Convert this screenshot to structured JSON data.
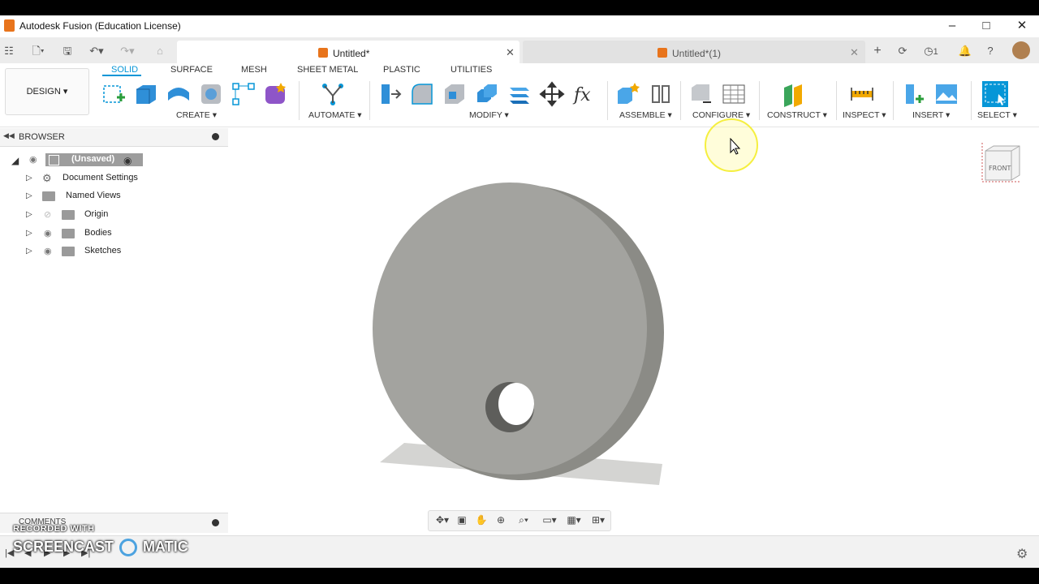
{
  "window": {
    "title": "Autodesk Fusion (Education License)"
  },
  "tabs": [
    {
      "label": "Untitled*",
      "active": true
    },
    {
      "label": "Untitled*(1)",
      "active": false
    }
  ],
  "topbar": {
    "job_count": "1"
  },
  "workspace": {
    "label": "DESIGN ▾"
  },
  "ribbon_tabs": [
    "SOLID",
    "SURFACE",
    "MESH",
    "SHEET METAL",
    "PLASTIC",
    "UTILITIES"
  ],
  "groups": {
    "create": "CREATE ▾",
    "automate": "AUTOMATE ▾",
    "modify": "MODIFY ▾",
    "assemble": "ASSEMBLE ▾",
    "configure": "CONFIGURE ▾",
    "construct": "CONSTRUCT ▾",
    "inspect": "INSPECT ▾",
    "insert": "INSERT ▾",
    "select": "SELECT ▾"
  },
  "browser": {
    "title": "BROWSER",
    "root": "(Unsaved)",
    "items": [
      "Document Settings",
      "Named Views",
      "Origin",
      "Bodies",
      "Sketches"
    ]
  },
  "viewcube": {
    "face": "FRONT"
  },
  "comments": {
    "title": "COMMENTS"
  },
  "watermark": {
    "line1": "RECORDED WITH",
    "line2_a": "SCREENCAST",
    "line2_b": "MATIC"
  },
  "colors": {
    "accent": "#0696d7",
    "body": "#a3a39f",
    "body_edge": "#8b8b86",
    "brand": "#e8741c"
  }
}
